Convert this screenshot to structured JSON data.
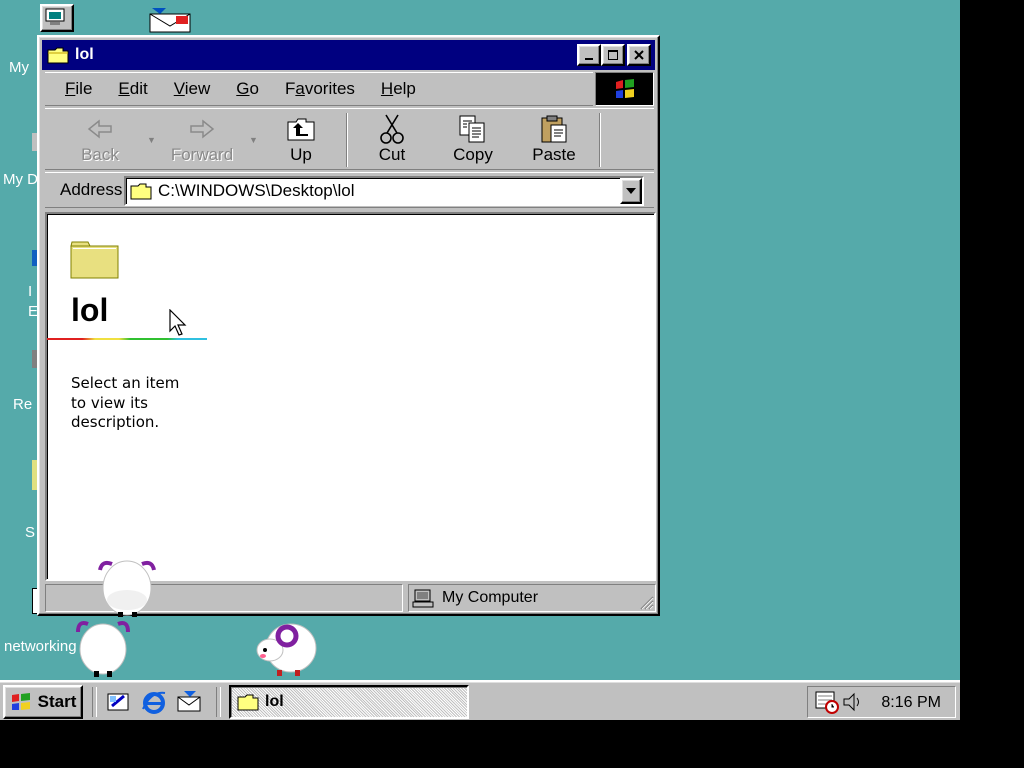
{
  "desktop": {
    "background": "#55aaaa",
    "icon_labels": [
      "My",
      "My D",
      "I",
      "E",
      "Re",
      "S",
      "networking"
    ]
  },
  "window": {
    "title": "lol",
    "title_icon": "folder-icon",
    "caption_buttons": [
      "minimize-icon",
      "maximize-icon",
      "close-icon"
    ],
    "menu": [
      {
        "key": "F",
        "rest": "ile"
      },
      {
        "key": "E",
        "rest": "dit"
      },
      {
        "key": "V",
        "rest": "iew"
      },
      {
        "key": "G",
        "rest": "o"
      },
      {
        "key": "a",
        "pre": "F",
        "rest": "vorites"
      },
      {
        "key": "H",
        "rest": "elp"
      }
    ],
    "toolbar": {
      "back": "Back",
      "forward": "Forward",
      "up": "Up",
      "cut": "Cut",
      "copy": "Copy",
      "paste": "Paste"
    },
    "address": {
      "label": "Address",
      "value": "C:\\WINDOWS\\Desktop\\lol"
    },
    "content": {
      "folder_title": "lol",
      "description": "Select an item to view its description."
    },
    "status": {
      "zone": "My Computer"
    }
  },
  "taskbar": {
    "start_label": "Start",
    "quick_launch": [
      "show-desktop-icon",
      "internet-explorer-icon",
      "outlook-express-icon"
    ],
    "task_button": "lol",
    "tray_icons": [
      "scheduler-icon",
      "volume-icon"
    ],
    "clock": "8:16 PM"
  },
  "colors": {
    "titlebar": "#000080",
    "face": "#c0c0c0",
    "desktop": "#55aaaa"
  }
}
